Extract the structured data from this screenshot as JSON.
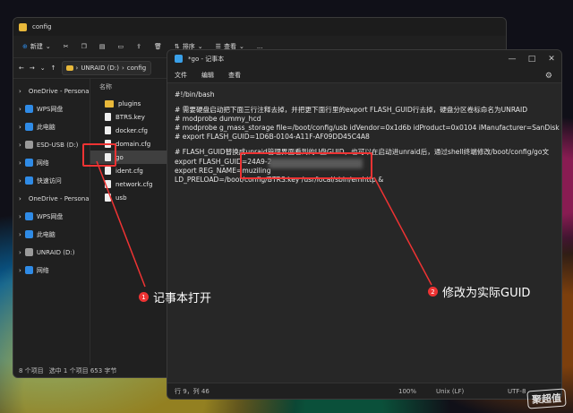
{
  "explorer": {
    "title": "config",
    "toolbar": {
      "new_label": "新建",
      "sort_label": "排序",
      "view_label": "查看",
      "more_label": "..."
    },
    "address": {
      "drive": "UNRAID (D:)",
      "separator": "›",
      "folder": "config"
    },
    "nav_items": [
      {
        "label": "OneDrive - Personal",
        "icon": "cloud-icon",
        "color": "#2f8be6"
      },
      {
        "label": "WPS网盘",
        "icon": "cloud-icon",
        "color": "#2f8be6"
      },
      {
        "label": "此电脑",
        "icon": "computer-icon",
        "color": "#2f8be6"
      },
      {
        "label": "ESD-USB (D:)",
        "icon": "drive-icon",
        "color": "#9a9a9a"
      },
      {
        "label": "网络",
        "icon": "network-icon",
        "color": "#2f8be6"
      },
      {
        "label": "快速访问",
        "icon": "star-icon",
        "color": "#2f8be6"
      },
      {
        "label": "OneDrive - Personal",
        "icon": "cloud-icon",
        "color": "#2f8be6"
      },
      {
        "label": "WPS网盘",
        "icon": "cloud-icon",
        "color": "#2f8be6"
      },
      {
        "label": "此电脑",
        "icon": "computer-icon",
        "color": "#2f8be6"
      },
      {
        "label": "UNRAID (D:)",
        "icon": "drive-icon",
        "color": "#9a9a9a"
      },
      {
        "label": "网络",
        "icon": "network-icon",
        "color": "#2f8be6"
      }
    ],
    "column_header": "名称",
    "files": [
      {
        "name": "plugins",
        "type": "folder"
      },
      {
        "name": "BTRS.key",
        "type": "file"
      },
      {
        "name": "docker.cfg",
        "type": "file"
      },
      {
        "name": "domain.cfg",
        "type": "file"
      },
      {
        "name": "go",
        "type": "file",
        "selected": true
      },
      {
        "name": "ident.cfg",
        "type": "file"
      },
      {
        "name": "network.cfg",
        "type": "file"
      },
      {
        "name": "usb",
        "type": "file"
      }
    ],
    "status": {
      "count": "8 个项目",
      "selection": "选中 1 个项目  653 字节"
    }
  },
  "notepad": {
    "title": "*go - 记事本",
    "menu": [
      "文件",
      "编辑",
      "查看"
    ],
    "lines": [
      "#!/bin/bash",
      "",
      "# 需要硬盘启动把下面三行注释去掉，并把更下面行里的export FLASH_GUID行去掉，硬盘分区卷标命名为UNRAID",
      "# modprobe dummy_hcd",
      "# modprobe g_mass_storage file=/boot/config/usb idVendor=0x1d6b idProduct=0x0104 iManufacturer=SanDisk iP",
      "# export FLASH_GUID=1D6B-0104-A11F-AF09DD45C4A8",
      "",
      "# FLASH_GUID替换成unraid管理界面看到的U盘GUID，也可以在启动进unraid后，通过shell终端修改/boot/config/go文",
      "export FLASH_GUID=24A9-2",
      "export REG_NAME=muziling",
      "LD_PRELOAD=/boot/config/BTRS.key /usr/local/sbin/emhttp &"
    ],
    "status": {
      "position": "行 9，列 46",
      "zoom": "100%",
      "eol": "Unix (LF)",
      "encoding": "UTF-8"
    }
  },
  "annotations": [
    {
      "number": "1",
      "text": "记事本打开"
    },
    {
      "number": "2",
      "text": "修改为实际GUID"
    }
  ],
  "watermark": "聚超值",
  "colors": {
    "annotation_red": "#e33333",
    "accent": "#2f8be6"
  }
}
